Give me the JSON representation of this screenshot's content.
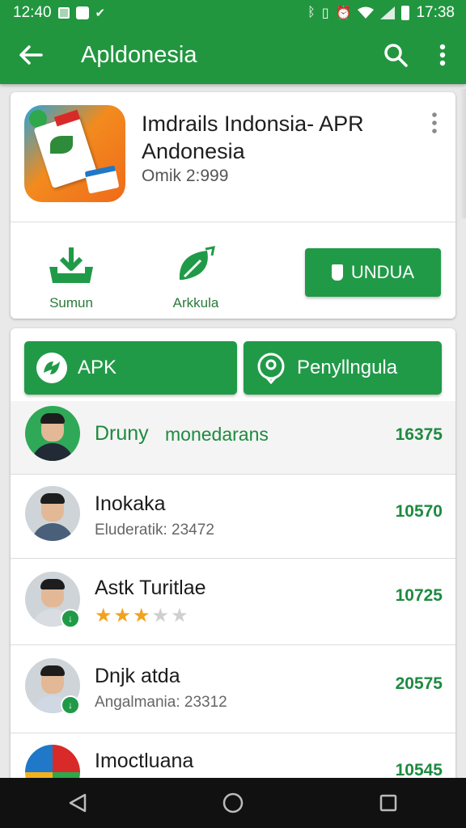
{
  "status_bar": {
    "time_left": "12:40",
    "time_right": "17:38"
  },
  "toolbar": {
    "title": "Apldonesia",
    "icons": [
      "back-arrow-icon",
      "search-icon",
      "more-vert-icon"
    ]
  },
  "app": {
    "name": "Imdrails Indonsia- APR Andonesia",
    "meta": "Omik 2:999",
    "actions": [
      {
        "label": "Sumun",
        "icon": "download-icon"
      },
      {
        "label": "Arkkula",
        "icon": "leaf-share-icon"
      }
    ],
    "download_label": "UNDUA"
  },
  "filters": {
    "apk_label": "APK",
    "second_label": "Penyllngula"
  },
  "list": {
    "first": {
      "name": "Druny",
      "subtitle": "monedarans",
      "count": "16375"
    },
    "items": [
      {
        "title": "Inokaka",
        "subtitle": "Eluderatik: 23472",
        "count": "10570"
      },
      {
        "title": "Astk Turitlae",
        "rating": 3,
        "rating_max": 5,
        "count": "10725"
      },
      {
        "title": "Dnjk atda",
        "subtitle": "Angalmania: 23312",
        "count": "20575"
      },
      {
        "title": "Imoctluana",
        "count": "10545"
      }
    ]
  },
  "colors": {
    "primary": "#21963f",
    "button": "#219a48",
    "accent_text": "#1e8a40",
    "star": "#f2a21e"
  }
}
